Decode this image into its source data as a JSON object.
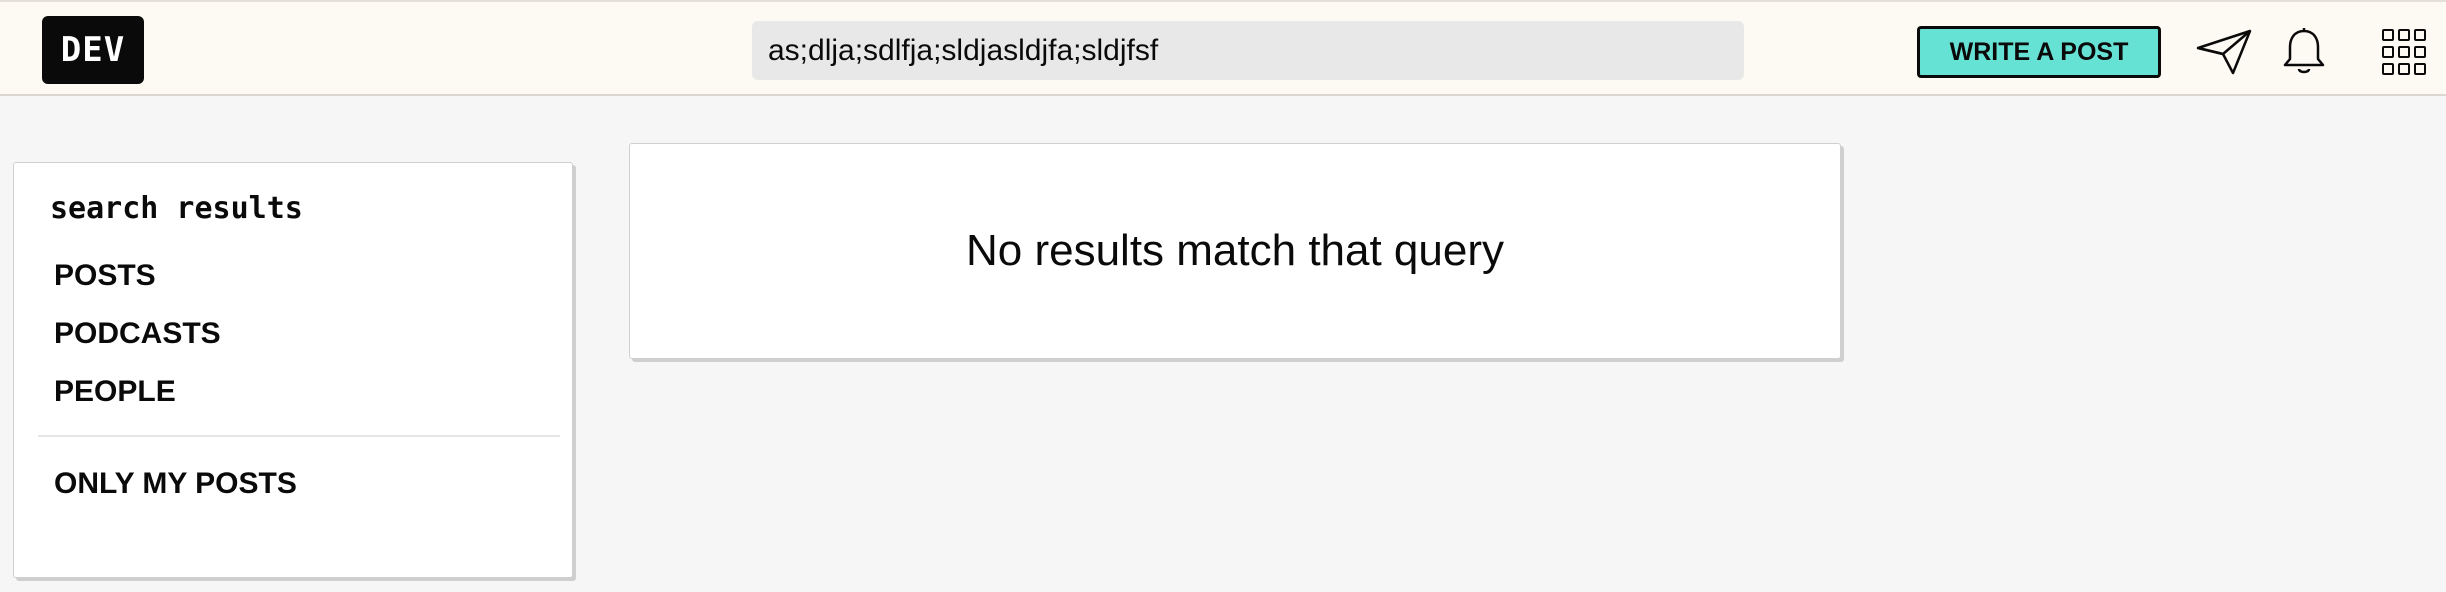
{
  "header": {
    "logo_text": "DEV",
    "search_value": "as;dlja;sdlfja;sldjasldjfa;sldjfsf",
    "write_post_label": "WRITE A POST",
    "icons": [
      "paper-plane-icon",
      "bell-icon",
      "apps-grid-icon"
    ],
    "accent_color": "#66e2d5"
  },
  "sidebar": {
    "title": "search results",
    "links": [
      "POSTS",
      "PODCASTS",
      "PEOPLE"
    ],
    "filter_label": "ONLY MY POSTS"
  },
  "results": {
    "message": "No results match that query"
  }
}
